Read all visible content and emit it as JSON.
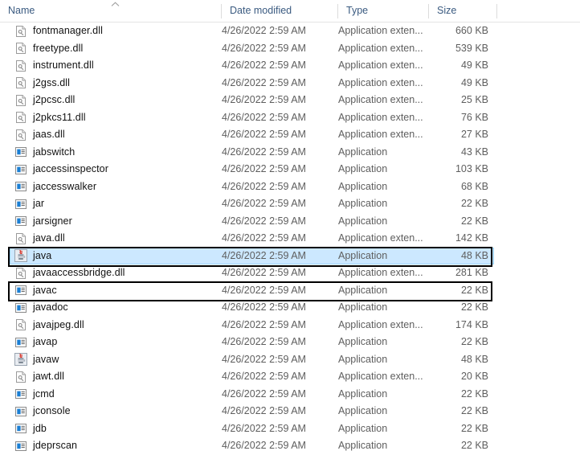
{
  "window": {
    "title": "File Explorer file list"
  },
  "columns": [
    {
      "key": "name",
      "label": "Name",
      "sort": "ascending",
      "sort_icon": "chevron-up-icon"
    },
    {
      "key": "date",
      "label": "Date modified",
      "sort": "none"
    },
    {
      "key": "type",
      "label": "Type",
      "sort": "none"
    },
    {
      "key": "size",
      "label": "Size",
      "sort": "none"
    }
  ],
  "types": {
    "application": "Application",
    "extension": "Application exten..."
  },
  "icons": {
    "dll": "dll-file-icon",
    "exe": "application-exe-icon",
    "java": "java-coffee-cup-icon"
  },
  "colors": {
    "selection_fill": "#cce8ff",
    "selection_border": "#99d1ff",
    "header_text": "#3a5a80",
    "row_text": "#111111",
    "secondary_text": "#5e5e5e",
    "annotation_border": "#000000",
    "grid_divider": "#dcdcdc"
  },
  "files": [
    {
      "name": "fontmanager.dll",
      "date": "4/26/2022 2:59 AM",
      "type": "Application exten...",
      "size": "660 KB",
      "icon": "dll-file-icon",
      "selected": false,
      "annotated": false
    },
    {
      "name": "freetype.dll",
      "date": "4/26/2022 2:59 AM",
      "type": "Application exten...",
      "size": "539 KB",
      "icon": "dll-file-icon",
      "selected": false,
      "annotated": false
    },
    {
      "name": "instrument.dll",
      "date": "4/26/2022 2:59 AM",
      "type": "Application exten...",
      "size": "49 KB",
      "icon": "dll-file-icon",
      "selected": false,
      "annotated": false
    },
    {
      "name": "j2gss.dll",
      "date": "4/26/2022 2:59 AM",
      "type": "Application exten...",
      "size": "49 KB",
      "icon": "dll-file-icon",
      "selected": false,
      "annotated": false
    },
    {
      "name": "j2pcsc.dll",
      "date": "4/26/2022 2:59 AM",
      "type": "Application exten...",
      "size": "25 KB",
      "icon": "dll-file-icon",
      "selected": false,
      "annotated": false
    },
    {
      "name": "j2pkcs11.dll",
      "date": "4/26/2022 2:59 AM",
      "type": "Application exten...",
      "size": "76 KB",
      "icon": "dll-file-icon",
      "selected": false,
      "annotated": false
    },
    {
      "name": "jaas.dll",
      "date": "4/26/2022 2:59 AM",
      "type": "Application exten...",
      "size": "27 KB",
      "icon": "dll-file-icon",
      "selected": false,
      "annotated": false
    },
    {
      "name": "jabswitch",
      "date": "4/26/2022 2:59 AM",
      "type": "Application",
      "size": "43 KB",
      "icon": "application-exe-icon",
      "selected": false,
      "annotated": false
    },
    {
      "name": "jaccessinspector",
      "date": "4/26/2022 2:59 AM",
      "type": "Application",
      "size": "103 KB",
      "icon": "application-exe-icon",
      "selected": false,
      "annotated": false
    },
    {
      "name": "jaccesswalker",
      "date": "4/26/2022 2:59 AM",
      "type": "Application",
      "size": "68 KB",
      "icon": "application-exe-icon",
      "selected": false,
      "annotated": false
    },
    {
      "name": "jar",
      "date": "4/26/2022 2:59 AM",
      "type": "Application",
      "size": "22 KB",
      "icon": "application-exe-icon",
      "selected": false,
      "annotated": false
    },
    {
      "name": "jarsigner",
      "date": "4/26/2022 2:59 AM",
      "type": "Application",
      "size": "22 KB",
      "icon": "application-exe-icon",
      "selected": false,
      "annotated": false
    },
    {
      "name": "java.dll",
      "date": "4/26/2022 2:59 AM",
      "type": "Application exten...",
      "size": "142 KB",
      "icon": "dll-file-icon",
      "selected": false,
      "annotated": false
    },
    {
      "name": "java",
      "date": "4/26/2022 2:59 AM",
      "type": "Application",
      "size": "48 KB",
      "icon": "java-coffee-cup-icon",
      "selected": true,
      "annotated": true
    },
    {
      "name": "javaaccessbridge.dll",
      "date": "4/26/2022 2:59 AM",
      "type": "Application exten...",
      "size": "281 KB",
      "icon": "dll-file-icon",
      "selected": false,
      "annotated": false
    },
    {
      "name": "javac",
      "date": "4/26/2022 2:59 AM",
      "type": "Application",
      "size": "22 KB",
      "icon": "application-exe-icon",
      "selected": false,
      "annotated": true
    },
    {
      "name": "javadoc",
      "date": "4/26/2022 2:59 AM",
      "type": "Application",
      "size": "22 KB",
      "icon": "application-exe-icon",
      "selected": false,
      "annotated": false
    },
    {
      "name": "javajpeg.dll",
      "date": "4/26/2022 2:59 AM",
      "type": "Application exten...",
      "size": "174 KB",
      "icon": "dll-file-icon",
      "selected": false,
      "annotated": false
    },
    {
      "name": "javap",
      "date": "4/26/2022 2:59 AM",
      "type": "Application",
      "size": "22 KB",
      "icon": "application-exe-icon",
      "selected": false,
      "annotated": false
    },
    {
      "name": "javaw",
      "date": "4/26/2022 2:59 AM",
      "type": "Application",
      "size": "48 KB",
      "icon": "java-coffee-cup-icon",
      "selected": false,
      "annotated": false
    },
    {
      "name": "jawt.dll",
      "date": "4/26/2022 2:59 AM",
      "type": "Application exten...",
      "size": "20 KB",
      "icon": "dll-file-icon",
      "selected": false,
      "annotated": false
    },
    {
      "name": "jcmd",
      "date": "4/26/2022 2:59 AM",
      "type": "Application",
      "size": "22 KB",
      "icon": "application-exe-icon",
      "selected": false,
      "annotated": false
    },
    {
      "name": "jconsole",
      "date": "4/26/2022 2:59 AM",
      "type": "Application",
      "size": "22 KB",
      "icon": "application-exe-icon",
      "selected": false,
      "annotated": false
    },
    {
      "name": "jdb",
      "date": "4/26/2022 2:59 AM",
      "type": "Application",
      "size": "22 KB",
      "icon": "application-exe-icon",
      "selected": false,
      "annotated": false
    },
    {
      "name": "jdeprscan",
      "date": "4/26/2022 2:59 AM",
      "type": "Application",
      "size": "22 KB",
      "icon": "application-exe-icon",
      "selected": false,
      "annotated": false
    }
  ]
}
